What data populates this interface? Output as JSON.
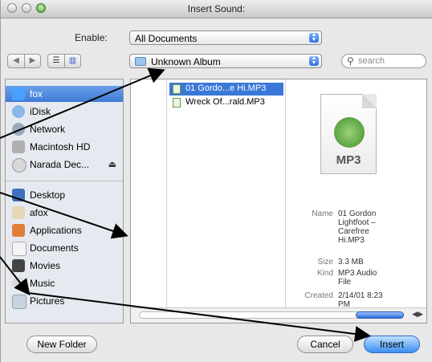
{
  "window": {
    "title": "Insert Sound:"
  },
  "toolbar": {
    "enable_label": "Enable:",
    "enable_value": "All Documents",
    "location_value": "Unknown Album",
    "search_placeholder": "search"
  },
  "sidebar": {
    "devices": [
      {
        "label": "fox",
        "icon": "computer-icon",
        "selected": true
      },
      {
        "label": "iDisk",
        "icon": "idisk-icon"
      },
      {
        "label": "Network",
        "icon": "network-icon"
      },
      {
        "label": "Macintosh HD",
        "icon": "hard-disk-icon"
      },
      {
        "label": "Narada Dec...",
        "icon": "cd-icon"
      }
    ],
    "places": [
      {
        "label": "Desktop",
        "icon": "desktop-icon"
      },
      {
        "label": "afox",
        "icon": "home-icon"
      },
      {
        "label": "Applications",
        "icon": "applications-icon"
      },
      {
        "label": "Documents",
        "icon": "documents-icon"
      },
      {
        "label": "Movies",
        "icon": "movies-icon"
      },
      {
        "label": "Music",
        "icon": "music-icon"
      },
      {
        "label": "Pictures",
        "icon": "pictures-icon"
      }
    ]
  },
  "files": [
    {
      "name": "01 Gordo...e Hi.MP3",
      "selected": true
    },
    {
      "name": "Wreck Of...rald.MP3",
      "selected": false
    }
  ],
  "preview": {
    "file_type": "MP3",
    "name_label": "Name",
    "name_value": "01 Gordon Lightfoot – Carefree Hi.MP3",
    "size_label": "Size",
    "size_value": "3.3 MB",
    "kind_label": "Kind",
    "kind_value": "MP3 Audio File",
    "created_label": "Created",
    "created_value": "2/14/01 8:23 PM"
  },
  "buttons": {
    "new_folder": "New Folder",
    "cancel": "Cancel",
    "insert": "Insert"
  },
  "colors": {
    "accent": "#3a78d8",
    "selected_sidebar": "#3f7ad6"
  }
}
